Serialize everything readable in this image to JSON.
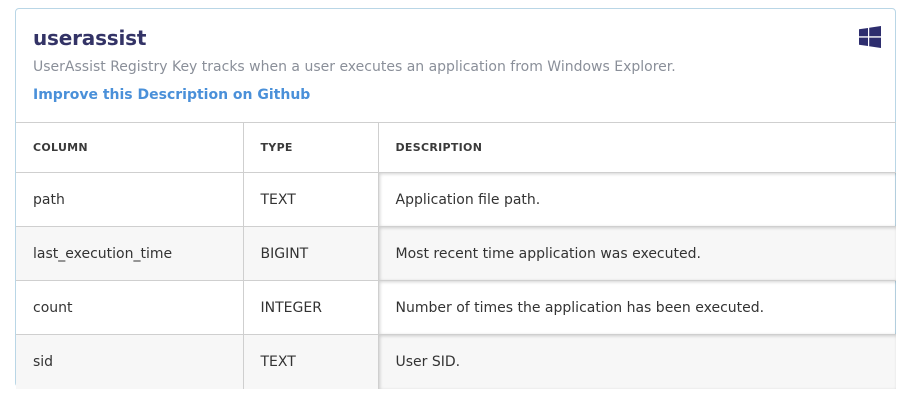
{
  "table_info": {
    "name": "userassist",
    "description": "UserAssist Registry Key tracks when a user executes an application from Windows Explorer.",
    "improve_link": "Improve this Description on Github",
    "platform_icon": "windows-icon",
    "brand_color": "#333366",
    "link_color": "#4a90d9"
  },
  "schema": {
    "headers": [
      "COLUMN",
      "TYPE",
      "DESCRIPTION"
    ],
    "rows": [
      {
        "column": "path",
        "type": "TEXT",
        "description": "Application file path."
      },
      {
        "column": "last_execution_time",
        "type": "BIGINT",
        "description": "Most recent time application was executed."
      },
      {
        "column": "count",
        "type": "INTEGER",
        "description": "Number of times the application has been executed."
      },
      {
        "column": "sid",
        "type": "TEXT",
        "description": "User SID."
      }
    ]
  }
}
